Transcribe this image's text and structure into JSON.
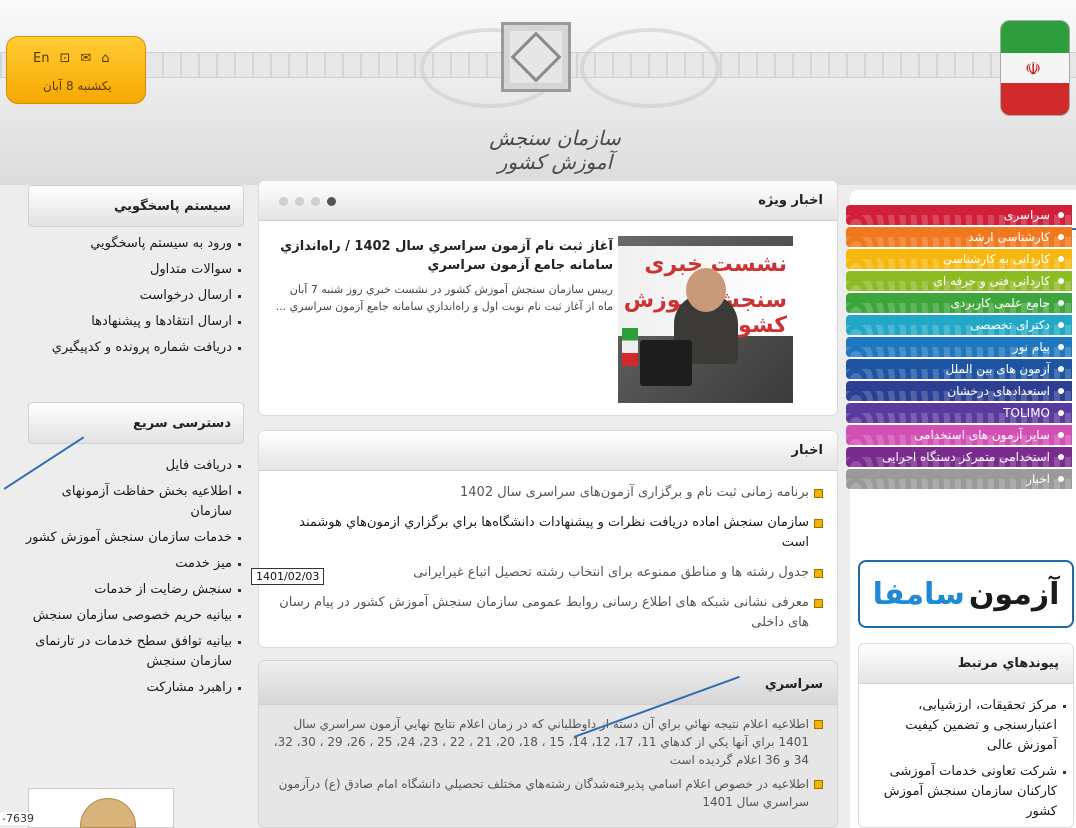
{
  "header": {
    "org_name": "سازمان سنجش آموزش کشور",
    "tools": {
      "lang": "En",
      "icons": [
        "sitemap-icon",
        "mail-icon",
        "home-icon"
      ],
      "date": "يكشنبه 8 آبان"
    }
  },
  "right_menu": {
    "items": [
      {
        "label": "سراسری",
        "color": "#d11f3a"
      },
      {
        "label": "کارشناسی ارشد",
        "color": "#f0781e"
      },
      {
        "label": "کاردانی به کارشناسی",
        "color": "#f6b80f"
      },
      {
        "label": "کاردانی فنی و حرفه ای",
        "color": "#8dbb24"
      },
      {
        "label": "جامع علمی کاربردی",
        "color": "#3da63a"
      },
      {
        "label": "دکترای تخصصی",
        "color": "#22a8c7"
      },
      {
        "label": "پیام نور",
        "color": "#1f77c0"
      },
      {
        "label": "آزمون های بین الملل",
        "color": "#1d55a3"
      },
      {
        "label": "استعدادهای درخشان",
        "color": "#2d3f92"
      },
      {
        "label": "TOLIMO",
        "color": "#5a3a9e"
      },
      {
        "label": "سایر آزمون های استخدامی",
        "color": "#d24fb3"
      },
      {
        "label": "استخدامی متمرکز دستگاه اجرایی",
        "color": "#7a2b8e"
      },
      {
        "label": "اخبار",
        "color": "#9a9a9a"
      }
    ]
  },
  "saamafa": {
    "main": "آزمون",
    "sub": "سامفا"
  },
  "related_links": {
    "title": "پيوندهاي مرتبط",
    "items": [
      "مرکز تحقیقات، ارزشیابی، اعتبارسنجی و تضمین کیفیت آموزش عالی",
      "شرکت تعاونی خدمات آموزشی کارکنان سازمان سنجش آموزش کشور"
    ]
  },
  "featured": {
    "title": "اخبار ويژه",
    "headline": "آغاز ثبت نام آزمون سراسري سال 1402 / راه‌اندازي سامانه جامع آزمون سراسري",
    "body": "رييس سازمان سنجش آموزش كشور در نشست خبري روز شنبه 7 آبان ماه از آغاز ثبت نام نوبت اول و راه‌اندازي سامانه جامع آزمون سراسري ...",
    "image_text_1": "نشست خبری",
    "image_text_2": "سنجش آموزش کشور"
  },
  "news": {
    "title": "اخبار",
    "items": [
      {
        "text": "برنامه زمانی ثبت نام و برگزاری آزمون‌های سراسری سال 1402",
        "dark": false
      },
      {
        "text": "سازمان سنجش اماده دريافت نظرات و پيشنهادات دانشگاه‌ها براي برگزاري ازمون‌هاي هوشمند است",
        "dark": true
      },
      {
        "text": "جدول رشته ها و مناطق ممنوعه برای انتخاب رشته تحصیل اتباع غیرایرانی",
        "dark": false
      },
      {
        "text": "معرفی نشانی شبکه های اطلاع رسانی روابط عمومی سازمان سنجش آموزش کشور در پیام رسان های داخلی",
        "dark": false
      }
    ],
    "tooltip_date": "1401/02/03"
  },
  "sarasari": {
    "title": "سراسري",
    "items": [
      "اطلاعيه اعلام نتيجه نهائي براي آن دسته از داوطلباني كه در زمان اعلام نتايج نهايي آزمون سراسري سال 1401 براي آنها يكي از كدهاي 11، 17، 12، 14، 15 ، 18، 20، 21 ، 22 ، 23، 24، 25 ، 26، 29 ، 30، 32، 34 و 36 اعلام گرديده است",
      "اطلاعيه در خصوص اعلام اسامي پذيرفته‌شدگان رشته‌هاي مختلف تحصيلي دانشگاه امام صادق (ع) درآزمون سراسري سال 1401"
    ]
  },
  "left": {
    "support": {
      "title": "سيستم پاسخگويي",
      "items": [
        "ورود به سيستم پاسخگويي",
        "سوالات متداول",
        "ارسال درخواست",
        "ارسال انتقادها و پيشنهادها",
        "دريافت شماره پرونده و كدپيگيري"
      ]
    },
    "quick": {
      "title": "دسترسی سریع",
      "items": [
        "دریافت فایل",
        "اطلاعیه بخش حفاظت آزمونهای سازمان",
        "خدمات سازمان سنجش آموزش کشور",
        "میز خدمت",
        "سنجش رضایت از خدمات",
        "بیانیه حریم خصوصی سازمان سنجش",
        "بیانیه توافق سطح خدمات در تارنمای سازمان سنجش",
        "راهبرد مشارکت"
      ]
    },
    "counter": "-7639"
  }
}
